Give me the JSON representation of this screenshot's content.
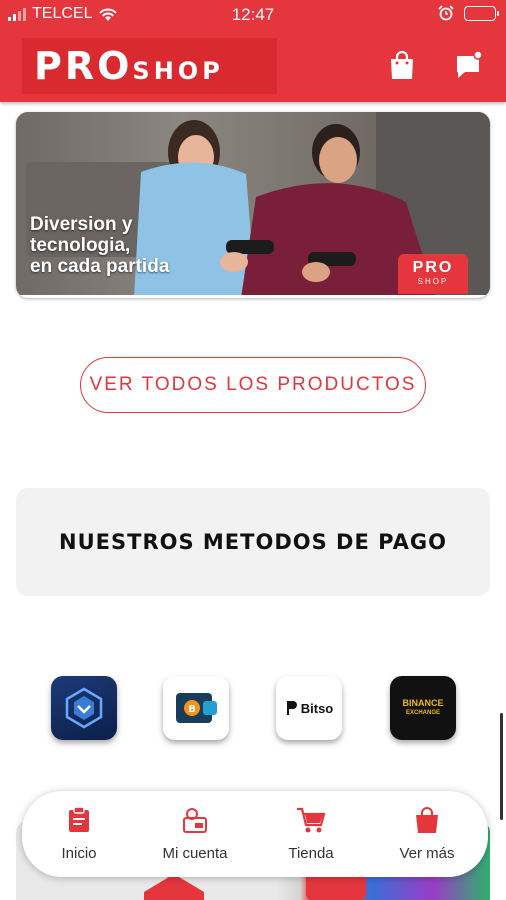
{
  "status_bar": {
    "carrier": "TELCEL",
    "time": "12:47"
  },
  "header": {
    "logo_pro": "PRO",
    "logo_shop": "SHOP"
  },
  "banner": {
    "line1": "Diversion y",
    "line2": "tecnologia,",
    "line3": "en cada partida",
    "badge_pro": "PRO",
    "badge_shop": "SHOP"
  },
  "cta": {
    "label": "VER TODOS LOS PRODUCTOS"
  },
  "payment": {
    "title": "NUESTROS METODOS DE PAGO",
    "methods": [
      {
        "name": "Crypto.com",
        "icon": "crypto-com-icon"
      },
      {
        "name": "Bitcoin wallet",
        "icon": "bitcoin-wallet-icon"
      },
      {
        "name": "Bitso",
        "label": "Bitso",
        "icon": "bitso-icon"
      },
      {
        "name": "Binance",
        "label1": "BINANCE",
        "label2": "EXCHANGE",
        "icon": "binance-icon"
      }
    ]
  },
  "tabs": [
    {
      "label": "Inicio",
      "icon": "home-clipboard-icon"
    },
    {
      "label": "Mi cuenta",
      "icon": "account-icon"
    },
    {
      "label": "Tienda",
      "icon": "cart-icon"
    },
    {
      "label": "Ver más",
      "icon": "shopping-bag-icon"
    }
  ],
  "colors": {
    "brand": "#e5363d",
    "card_bg": "#f2f2f2",
    "text": "#333333"
  }
}
